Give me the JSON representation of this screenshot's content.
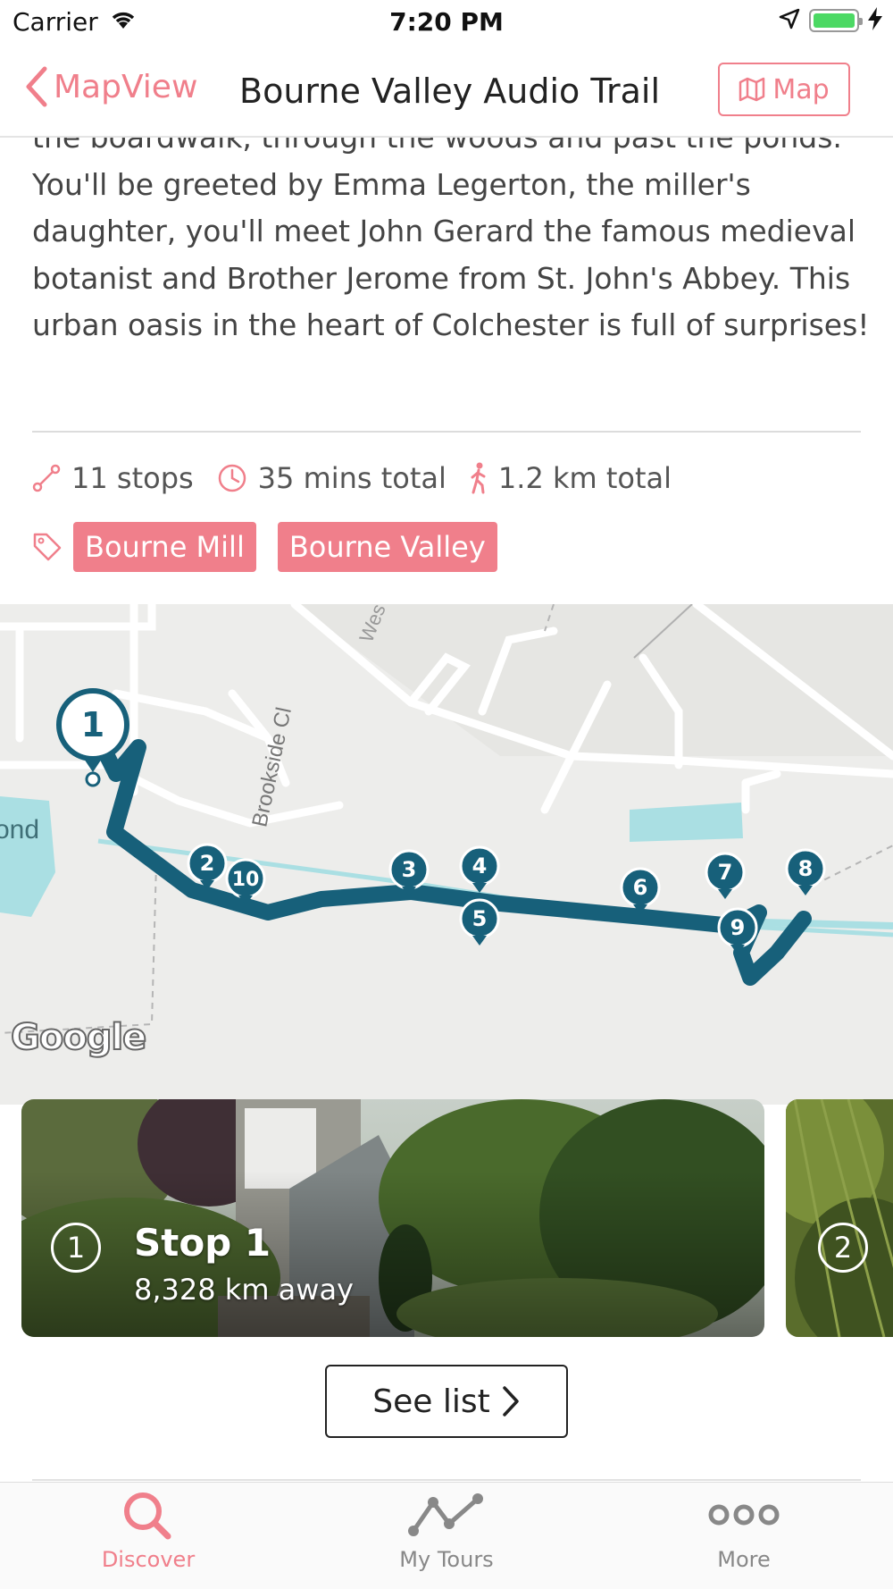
{
  "status_bar": {
    "carrier": "Carrier",
    "time": "7:20 PM"
  },
  "nav": {
    "back_label": "MapView",
    "title": "Bourne Valley Audio Trail",
    "map_button_label": "Map"
  },
  "description": "the boardwalk, through the woods and past the ponds. You'll be greeted by Emma Legerton, the miller's daughter, you'll meet John Gerard the famous medieval botanist and Brother Jerome from St. John's Abbey. This urban oasis in the heart of Colchester is full of surprises!",
  "stats": {
    "stops": "11 stops",
    "duration": "35 mins total",
    "distance": "1.2 km total"
  },
  "tags": [
    "Bourne Mill",
    "Bourne Valley"
  ],
  "map": {
    "street_labels": [
      "Brookside Cl",
      "Wes",
      "ond"
    ],
    "attribution": "Google",
    "markers": [
      "1",
      "2",
      "3",
      "4",
      "5",
      "6",
      "7",
      "8",
      "9",
      "10"
    ],
    "route_color": "#17607a"
  },
  "stops": [
    {
      "number": "1",
      "title": "Stop 1",
      "distance": "8,328 km away"
    },
    {
      "number": "2",
      "title": "",
      "distance": ""
    }
  ],
  "see_list_label": "See list",
  "tabs": [
    {
      "label": "Discover",
      "icon": "search-icon",
      "active": true
    },
    {
      "label": "My Tours",
      "icon": "route-line-icon",
      "active": false
    },
    {
      "label": "More",
      "icon": "more-dots-icon",
      "active": false
    }
  ],
  "colors": {
    "accent": "#f07f8b",
    "route": "#17607a",
    "water": "#aadfe3"
  }
}
